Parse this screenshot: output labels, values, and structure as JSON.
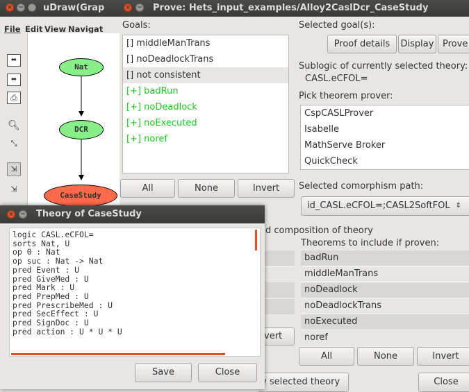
{
  "udraw": {
    "title": "uDraw(Grap",
    "menu": [
      "File",
      "Edit",
      "View",
      "Navigat"
    ],
    "nodes": [
      {
        "label": "Nat",
        "color": "#88f088"
      },
      {
        "label": "DCR",
        "color": "#88f088"
      },
      {
        "label": "CaseStudy",
        "color": "#ff6a4a"
      }
    ],
    "tool_icons": [
      "window-icon",
      "window-icon",
      "print-icon",
      "zoom-icon",
      "scale-icon",
      "layout-icon",
      "layout-icon"
    ]
  },
  "prove": {
    "title": "Prove: Hets_input_examples/Alloy2CaslDcr_CaseStudy",
    "goals_label": "Goals:",
    "goals": [
      {
        "text": "[] middleManTrans",
        "green": false,
        "selected": false
      },
      {
        "text": "[] noDeadlockTrans",
        "green": false,
        "selected": false
      },
      {
        "text": "[] not consistent",
        "green": false,
        "selected": true
      },
      {
        "text": "[+] badRun",
        "green": true,
        "selected": false
      },
      {
        "text": "[+] noDeadlock",
        "green": true,
        "selected": false
      },
      {
        "text": "[+] noExecuted",
        "green": true,
        "selected": false
      },
      {
        "text": "[+] noref",
        "green": true,
        "selected": false
      }
    ],
    "goal_buttons": {
      "all": "All",
      "none": "None",
      "invert": "Invert"
    },
    "selected_goals_label": "Selected goal(s):",
    "proof_details": "Proof details",
    "display": "Display",
    "prove": "Prove",
    "sublogic_label": "Sublogic of currently selected theory:",
    "sublogic_value": "CASL.eCFOL=",
    "prover_label": "Pick theorem prover:",
    "provers": [
      "CspCASLProver",
      "Isabelle",
      "MathServe Broker",
      "QuickCheck"
    ],
    "comorphism_label": "Selected comorphism path:",
    "comorphism_value": "id_CASL.eCFOL=;CASL2SoftFOL",
    "composition_label": "d composition of theory",
    "theorems_label": "Theorems to include if proven:",
    "theorems": [
      "badRun",
      "middleManTrans",
      "noDeadlock",
      "noDeadlockTrans",
      "noExecuted",
      "noref"
    ],
    "theorem_buttons": {
      "all": "All",
      "none": "None",
      "invert": "Invert"
    },
    "partial_invert": "vert",
    "selected_theory_button": "y selected theory",
    "close": "Close"
  },
  "theory": {
    "title": "Theory of CaseStudy",
    "lines": [
      "logic CASL.eCFOL=",
      "sorts Nat, U",
      "op 0 : Nat",
      "op suc : Nat -> Nat",
      "pred Event : U",
      "pred GiveMed : U",
      "pred Mark : U",
      "pred PrepMed : U",
      "pred PrescribeMed : U",
      "pred SecEffect : U",
      "pred SignDoc : U",
      "pred action : U * U * U"
    ],
    "save": "Save",
    "close": "Close"
  },
  "colors": {
    "accent": "#e0502a",
    "green_text": "#1ec81e"
  }
}
